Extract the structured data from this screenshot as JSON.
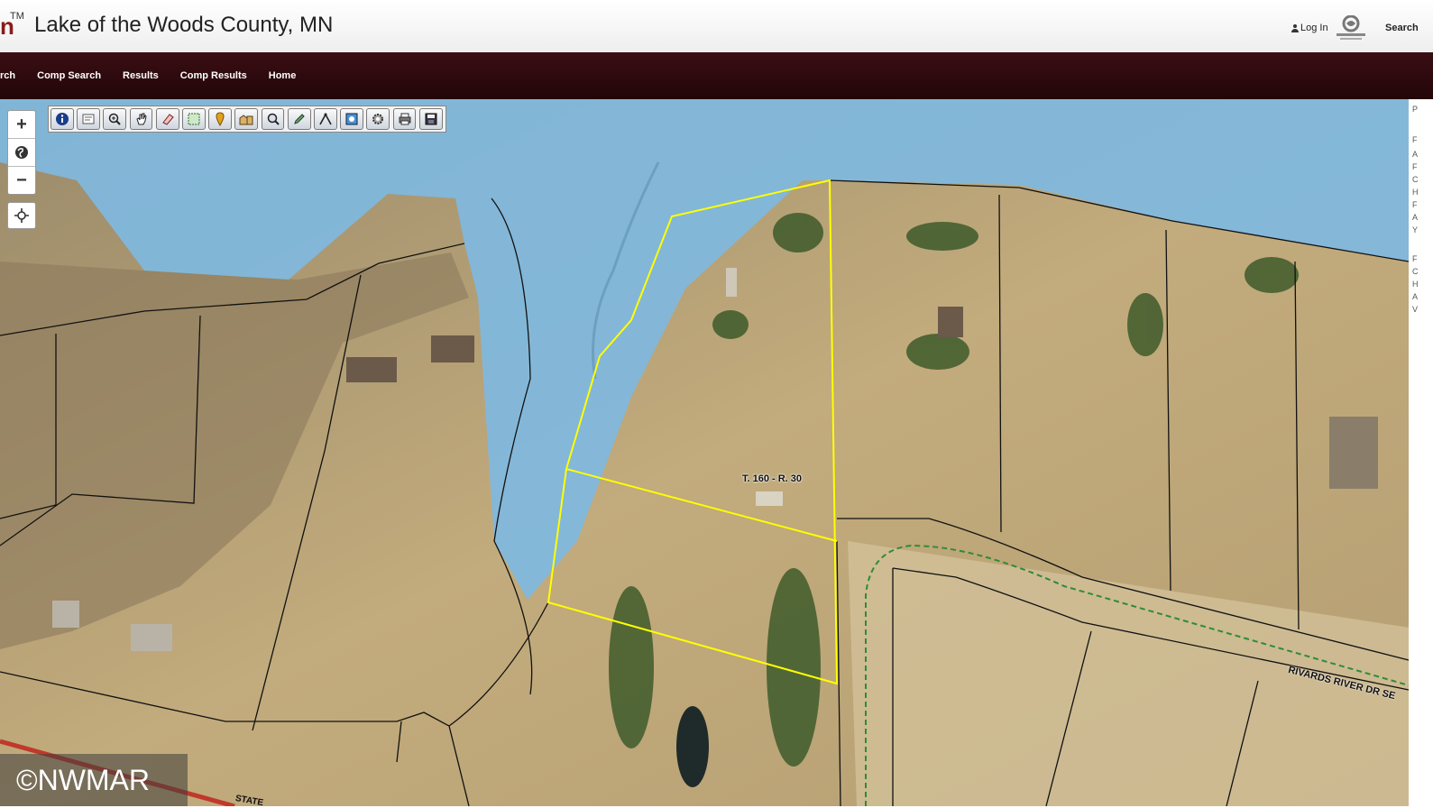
{
  "header": {
    "logo_fragment": "n",
    "tm": "TM",
    "title": "Lake of the Woods County, MN",
    "login_label": "Log In",
    "search_label": "Search",
    "user_icon": "user-icon",
    "partner_logo_icon": "schneider-logo-icon"
  },
  "nav": {
    "items": [
      {
        "label": "rch"
      },
      {
        "label": "Comp Search"
      },
      {
        "label": "Results"
      },
      {
        "label": "Comp Results"
      },
      {
        "label": "Home"
      }
    ]
  },
  "map": {
    "zoom_in": "+",
    "zoom_out": "−",
    "parcel_label": "T. 160 - R. 30",
    "road_label": "RIVARDS RIVER DR SE",
    "road_label_2": "STATE",
    "highlight_color": "#ffff00",
    "water_color": "#7fb8e0",
    "watermark": "©NWMAR"
  },
  "toolbar": {
    "tools": [
      "info-icon",
      "map-tip-icon",
      "zoom-in-tool-icon",
      "pan-hand-icon",
      "eraser-icon",
      "select-area-icon",
      "marker-icon",
      "buildings-icon",
      "search-map-icon",
      "draw-pencil-icon",
      "measure-icon",
      "full-extent-icon",
      "settings-icon",
      "print-icon",
      "save-icon"
    ]
  },
  "right_strip": {
    "chars": [
      "P",
      "F",
      "A",
      "F",
      "C",
      "H",
      "F",
      "A",
      "Y",
      "F",
      "C",
      "H",
      "A",
      "V"
    ]
  }
}
